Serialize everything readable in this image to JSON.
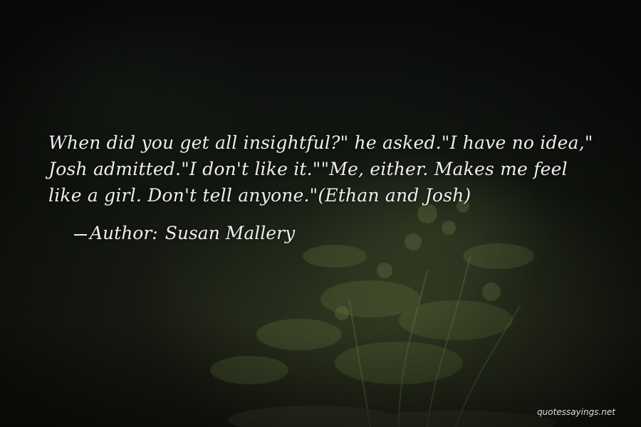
{
  "quote": {
    "text": "When did you get all insightful?\" he asked.\"I have no idea,\" Josh admitted.\"I don't like it.\"\"Me, either. Makes me feel like a girl. Don't tell anyone.\"(Ethan and Josh)",
    "author_label": "Author:",
    "author_name": "Susan Mallery"
  },
  "watermark": {
    "text": "quotessayings.net"
  },
  "colors": {
    "text": "#eeeeee",
    "background": "#0b0d0a",
    "foliage": "#4a5634"
  }
}
